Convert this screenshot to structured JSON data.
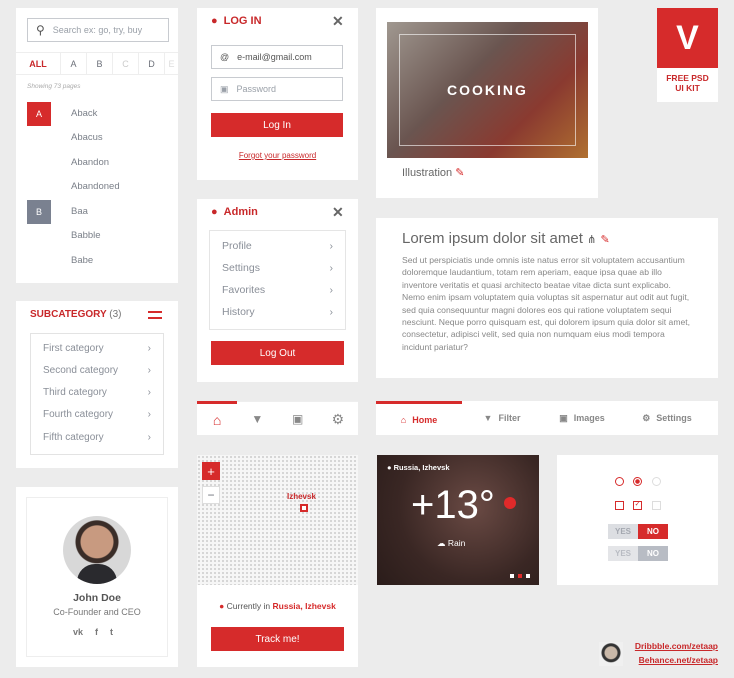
{
  "dictionary": {
    "search_placeholder": "Search ex: go, try, buy",
    "tabs": [
      "ALL",
      "A",
      "B",
      "C",
      "D",
      "E"
    ],
    "showing": "Showing 73 pages",
    "badges": [
      "A",
      "B"
    ],
    "words": [
      "Aback",
      "Abacus",
      "Abandon",
      "Abandoned",
      "Baa",
      "Babble",
      "Babe"
    ]
  },
  "login": {
    "title": "LOG IN",
    "email_value": "e-mail@gmail.com",
    "password_placeholder": "Password",
    "button": "Log In",
    "forgot": "Forgot your password"
  },
  "admin": {
    "title": "Admin",
    "items": [
      "Profile",
      "Settings",
      "Favorites",
      "History"
    ],
    "logout": "Log Out"
  },
  "subcategory": {
    "title": "SUBCATEGORY",
    "count": "(3)",
    "items": [
      "First category",
      "Second category",
      "Third category",
      "Fourth category",
      "Fifth category"
    ]
  },
  "profile": {
    "name": "John Doe",
    "role": "Co-Founder and CEO",
    "social": [
      "vk-icon",
      "facebook-icon",
      "twitter-icon"
    ]
  },
  "map": {
    "zoom_in": "+",
    "zoom_out": "−",
    "marker_label": "Izhevsk",
    "location_prefix": "Currently in",
    "location": "Russia, Izhevsk",
    "button": "Track me!"
  },
  "cooking": {
    "overlay": "COOKING",
    "caption": "Illustration"
  },
  "logo": {
    "letter": "V",
    "line1": "FREE PSD",
    "line2": "UI KIT"
  },
  "article": {
    "title": "Lorem ipsum dolor sit amet",
    "body": "Sed ut perspiciatis unde omnis iste natus error sit voluptatem accusantium doloremque laudantium, totam rem aperiam, eaque ipsa quae ab illo inventore veritatis et quasi architecto beatae vitae dicta sunt explicabo. Nemo enim ipsam voluptatem quia voluptas sit aspernatur aut odit aut fugit, sed quia consequuntur magni dolores eos qui ratione voluptatem sequi nesciunt. Neque porro quisquam est, qui dolorem ipsum quia dolor sit amet, consectetur, adipisci velit, sed quia non numquam eius modi tempora incidunt pariatur?"
  },
  "tabbar": {
    "items": [
      "Home",
      "Filter",
      "Images",
      "Settings"
    ],
    "active": 0
  },
  "weather": {
    "location": "Russia, Izhevsk",
    "temp": "+13°",
    "condition": "Rain",
    "active_dot": 1
  },
  "controls": {
    "yes": "YES",
    "no": "NO"
  },
  "footer": {
    "links": [
      "Dribbble.com/zetaap",
      "Behance.net/zetaap"
    ]
  },
  "colors": {
    "accent": "#d62b2b",
    "gray_badge": "#7a8190"
  }
}
